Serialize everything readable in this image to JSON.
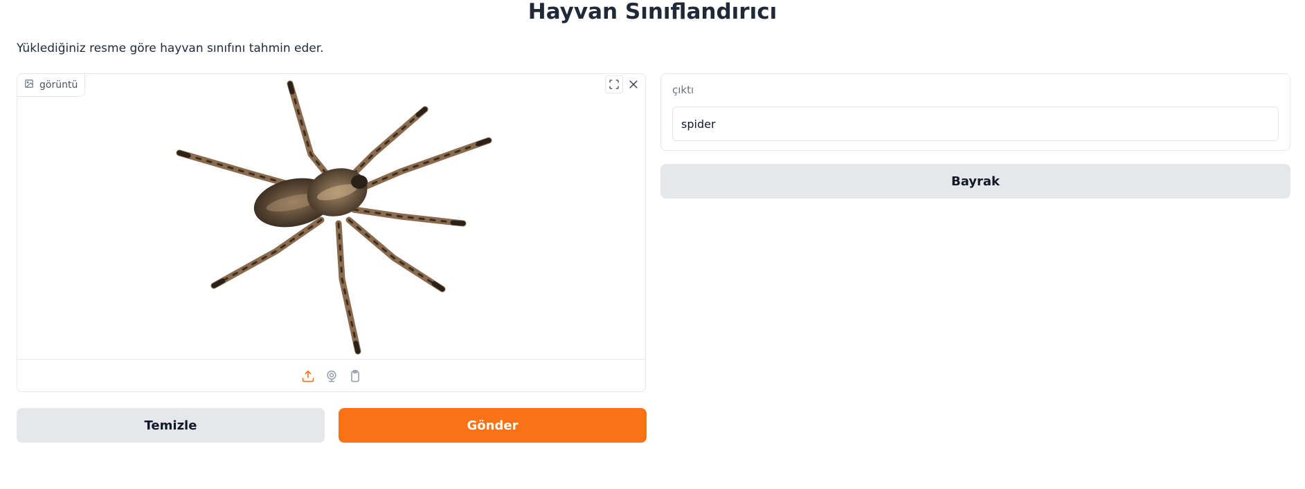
{
  "app": {
    "title": "Hayvan Sınıflandırıcı",
    "description": "Yüklediğiniz resme göre hayvan sınıfını tahmin eder."
  },
  "input_image": {
    "label": "görüntü",
    "label_icon": "image-icon",
    "top_buttons": [
      "fullscreen-icon",
      "close-icon"
    ],
    "source_buttons": [
      "upload-icon",
      "webcam-icon",
      "clipboard-icon"
    ]
  },
  "output": {
    "label": "çıktı",
    "value": "spider"
  },
  "buttons": {
    "clear": "Temizle",
    "submit": "Gönder",
    "flag": "Bayrak"
  },
  "colors": {
    "accent": "#f97316",
    "secondary_button": "#e5e7eb",
    "border": "#e5e7eb"
  }
}
